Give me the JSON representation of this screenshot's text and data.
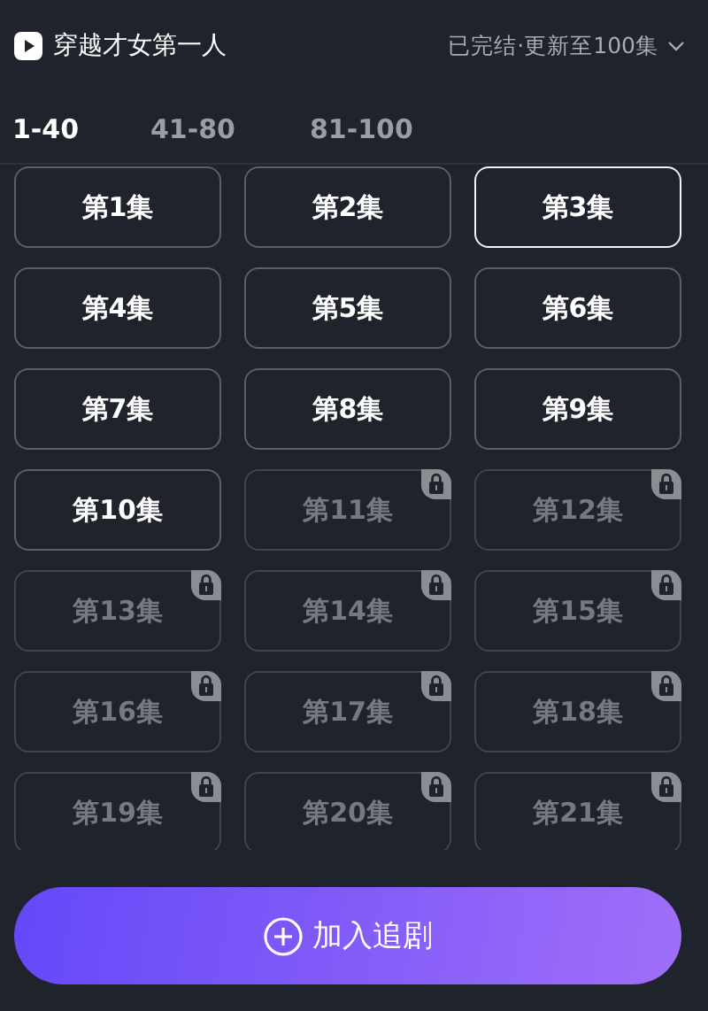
{
  "title": "穿越才女第一人",
  "status": "已完结·更新至100集",
  "tabs": [
    {
      "label": "1-40",
      "selected": true
    },
    {
      "label": "41-80",
      "selected": false
    },
    {
      "label": "81-100",
      "selected": false
    }
  ],
  "episodes": [
    {
      "label": "第1集",
      "selected": false,
      "locked": false
    },
    {
      "label": "第2集",
      "selected": false,
      "locked": false
    },
    {
      "label": "第3集",
      "selected": true,
      "locked": false
    },
    {
      "label": "第4集",
      "selected": false,
      "locked": false
    },
    {
      "label": "第5集",
      "selected": false,
      "locked": false
    },
    {
      "label": "第6集",
      "selected": false,
      "locked": false
    },
    {
      "label": "第7集",
      "selected": false,
      "locked": false
    },
    {
      "label": "第8集",
      "selected": false,
      "locked": false
    },
    {
      "label": "第9集",
      "selected": false,
      "locked": false
    },
    {
      "label": "第10集",
      "selected": false,
      "locked": false
    },
    {
      "label": "第11集",
      "selected": false,
      "locked": true
    },
    {
      "label": "第12集",
      "selected": false,
      "locked": true
    },
    {
      "label": "第13集",
      "selected": false,
      "locked": true
    },
    {
      "label": "第14集",
      "selected": false,
      "locked": true
    },
    {
      "label": "第15集",
      "selected": false,
      "locked": true
    },
    {
      "label": "第16集",
      "selected": false,
      "locked": true
    },
    {
      "label": "第17集",
      "selected": false,
      "locked": true
    },
    {
      "label": "第18集",
      "selected": false,
      "locked": true
    },
    {
      "label": "第19集",
      "selected": false,
      "locked": true
    },
    {
      "label": "第20集",
      "selected": false,
      "locked": true
    },
    {
      "label": "第21集",
      "selected": false,
      "locked": true
    }
  ],
  "action_button": "加入追剧"
}
